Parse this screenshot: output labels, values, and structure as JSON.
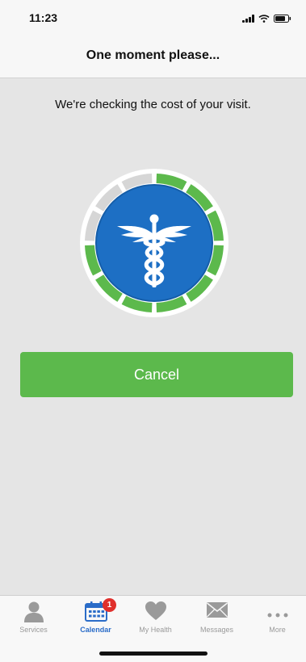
{
  "status_bar": {
    "time": "11:23"
  },
  "header": {
    "title": "One moment please..."
  },
  "main": {
    "message": "We're checking the cost of your visit.",
    "progress": {
      "segments_total": 12,
      "segments_complete": 9
    },
    "cancel_label": "Cancel"
  },
  "colors": {
    "accent_green": "#5cb94c",
    "logo_blue": "#1d6fc4",
    "active_tab": "#2a6cc8",
    "badge_red": "#e0302c"
  },
  "tab_bar": {
    "items": [
      {
        "label": "Services",
        "icon": "person-icon"
      },
      {
        "label": "Calendar",
        "icon": "calendar-icon",
        "active": true,
        "badge": "1"
      },
      {
        "label": "My Health",
        "icon": "heart-icon"
      },
      {
        "label": "Messages",
        "icon": "envelope-icon"
      },
      {
        "label": "More",
        "icon": "more-dots-icon"
      }
    ]
  }
}
